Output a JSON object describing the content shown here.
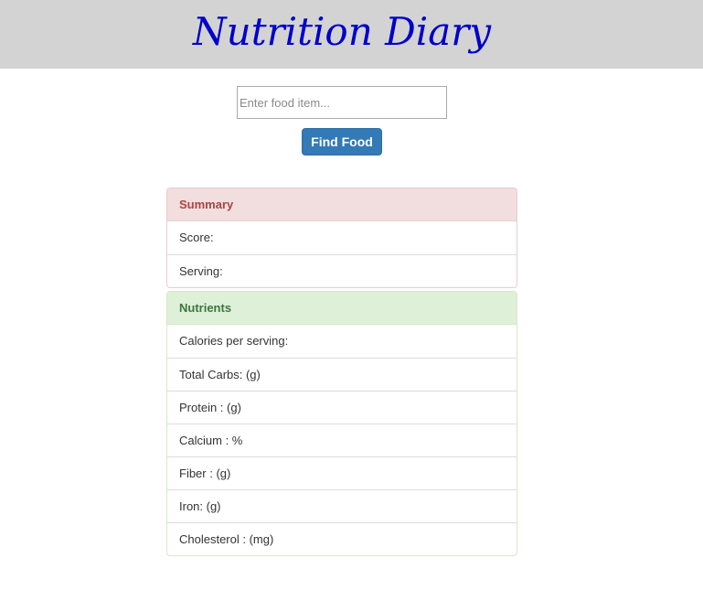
{
  "header": {
    "title": "Nutrition Diary"
  },
  "search": {
    "placeholder": "Enter food item...",
    "value": "",
    "button_label": "Find Food"
  },
  "summary": {
    "heading": "Summary",
    "rows": [
      "Score:",
      "Serving:"
    ]
  },
  "nutrients": {
    "heading": "Nutrients",
    "rows": [
      "Calories per serving:",
      "Total Carbs: (g)",
      "Protein : (g)",
      "Calcium : %",
      "Fiber : (g)",
      "Iron: (g)",
      "Cholesterol : (mg)"
    ]
  },
  "colors": {
    "header_bg": "#d3d3d3",
    "title": "#0000cc",
    "button": "#337ab7",
    "summary_heading_bg": "#f2dede",
    "summary_heading_text": "#a94442",
    "nutrients_heading_bg": "#dff0d8",
    "nutrients_heading_text": "#3c763d"
  }
}
